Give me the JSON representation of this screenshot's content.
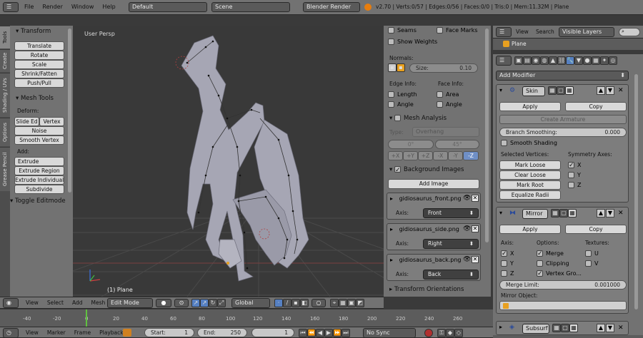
{
  "topbar": {
    "menus": [
      "File",
      "Render",
      "Window",
      "Help"
    ],
    "layout": "Default",
    "scene": "Scene",
    "engine": "Blender Render",
    "stats": "v2.70 | Verts:0/57 | Edges:0/56 | Faces:0/0 | Tris:0 | Mem:11.32M | Plane"
  },
  "tool_tabs": [
    "Tools",
    "Create",
    "Shading / UVs",
    "Options",
    "Grease Pencil"
  ],
  "toolshelf": {
    "transform_title": "Transform",
    "transform_buttons": [
      "Translate",
      "Rotate",
      "Scale",
      "Shrink/Fatten",
      "Push/Pull"
    ],
    "mesh_tools_title": "Mesh Tools",
    "deform_label": "Deform:",
    "deform_row": [
      "Slide Ed",
      "Vertex"
    ],
    "deform_buttons": [
      "Noise",
      "Smooth Vertex"
    ],
    "add_label": "Add:",
    "add_buttons": [
      "Extrude",
      "Extrude Region",
      "Extrude Individual",
      "Subdivide"
    ],
    "toggle": "Toggle Editmode"
  },
  "viewport": {
    "label": "User Persp",
    "object": "(1) Plane"
  },
  "properties_n": {
    "seams": "Seams",
    "face_marks": "Face Marks",
    "show_weights": "Show Weights",
    "normals": "Normals:",
    "size": "Size:",
    "size_val": "0.10",
    "edge_info": "Edge Info:",
    "face_info": "Face Info:",
    "length": "Length",
    "area": "Area",
    "angle1": "Angle",
    "angle2": "Angle",
    "mesh_analysis": "Mesh Analysis",
    "type_label": "Type:",
    "type_val": "Overhang",
    "deg_min": "0°",
    "deg_max": "45°",
    "axes": [
      "+X",
      "+Y",
      "+Z",
      "-X",
      "-Y",
      "-Z"
    ],
    "bg_images": "Background Images",
    "add_image": "Add Image",
    "images": [
      {
        "name": "gidiosaurus_front.png",
        "axis": "Front"
      },
      {
        "name": "gidiosaurus_side.png",
        "axis": "Right"
      },
      {
        "name": "gidiosaurus_back.png",
        "axis": "Back"
      }
    ],
    "axis_label": "Axis:",
    "transform_orient": "Transform Orientations"
  },
  "outliner": {
    "menus": [
      "View",
      "Search"
    ],
    "filter": "Visible Layers",
    "object": "Plane"
  },
  "modifiers": {
    "add_modifier": "Add Modifier",
    "skin": {
      "name": "Skin",
      "apply": "Apply",
      "copy": "Copy",
      "create_armature": "Create Armature",
      "branch": "Branch Smoothing:",
      "branch_val": "0.000",
      "smooth": "Smooth Shading",
      "sel_verts": "Selected Vertices:",
      "sym_axes": "Symmetry Axes:",
      "mark_loose": "Mark Loose",
      "clear_loose": "Clear Loose",
      "mark_root": "Mark Root",
      "equalize": "Equalize Radii",
      "x": "X",
      "y": "Y",
      "z": "Z"
    },
    "mirror": {
      "name": "Mirror",
      "apply": "Apply",
      "copy": "Copy",
      "axis": "Axis:",
      "options": "Options:",
      "textures": "Textures:",
      "x": "X",
      "y": "Y",
      "z": "Z",
      "merge": "Merge",
      "clipping": "Clipping",
      "vertex_groups": "Vertex Gro...",
      "u": "U",
      "v": "V",
      "merge_limit": "Merge Limit:",
      "merge_val": "0.001000",
      "mirror_object": "Mirror Object:"
    },
    "subsurf": {
      "name": "Subsurf"
    }
  },
  "view3d_header": {
    "menus": [
      "View",
      "Select",
      "Add",
      "Mesh"
    ],
    "mode": "Edit Mode",
    "orientation": "Global"
  },
  "timeline": {
    "ticks": [
      "-40",
      "-20",
      "0",
      "20",
      "40",
      "60",
      "80",
      "100",
      "120",
      "140",
      "160",
      "180",
      "200",
      "220",
      "240",
      "260"
    ],
    "menus": [
      "View",
      "Marker",
      "Frame",
      "Playback"
    ],
    "start": "Start:",
    "start_val": "1",
    "end": "End:",
    "end_val": "250",
    "current": "1",
    "sync": "No Sync"
  }
}
